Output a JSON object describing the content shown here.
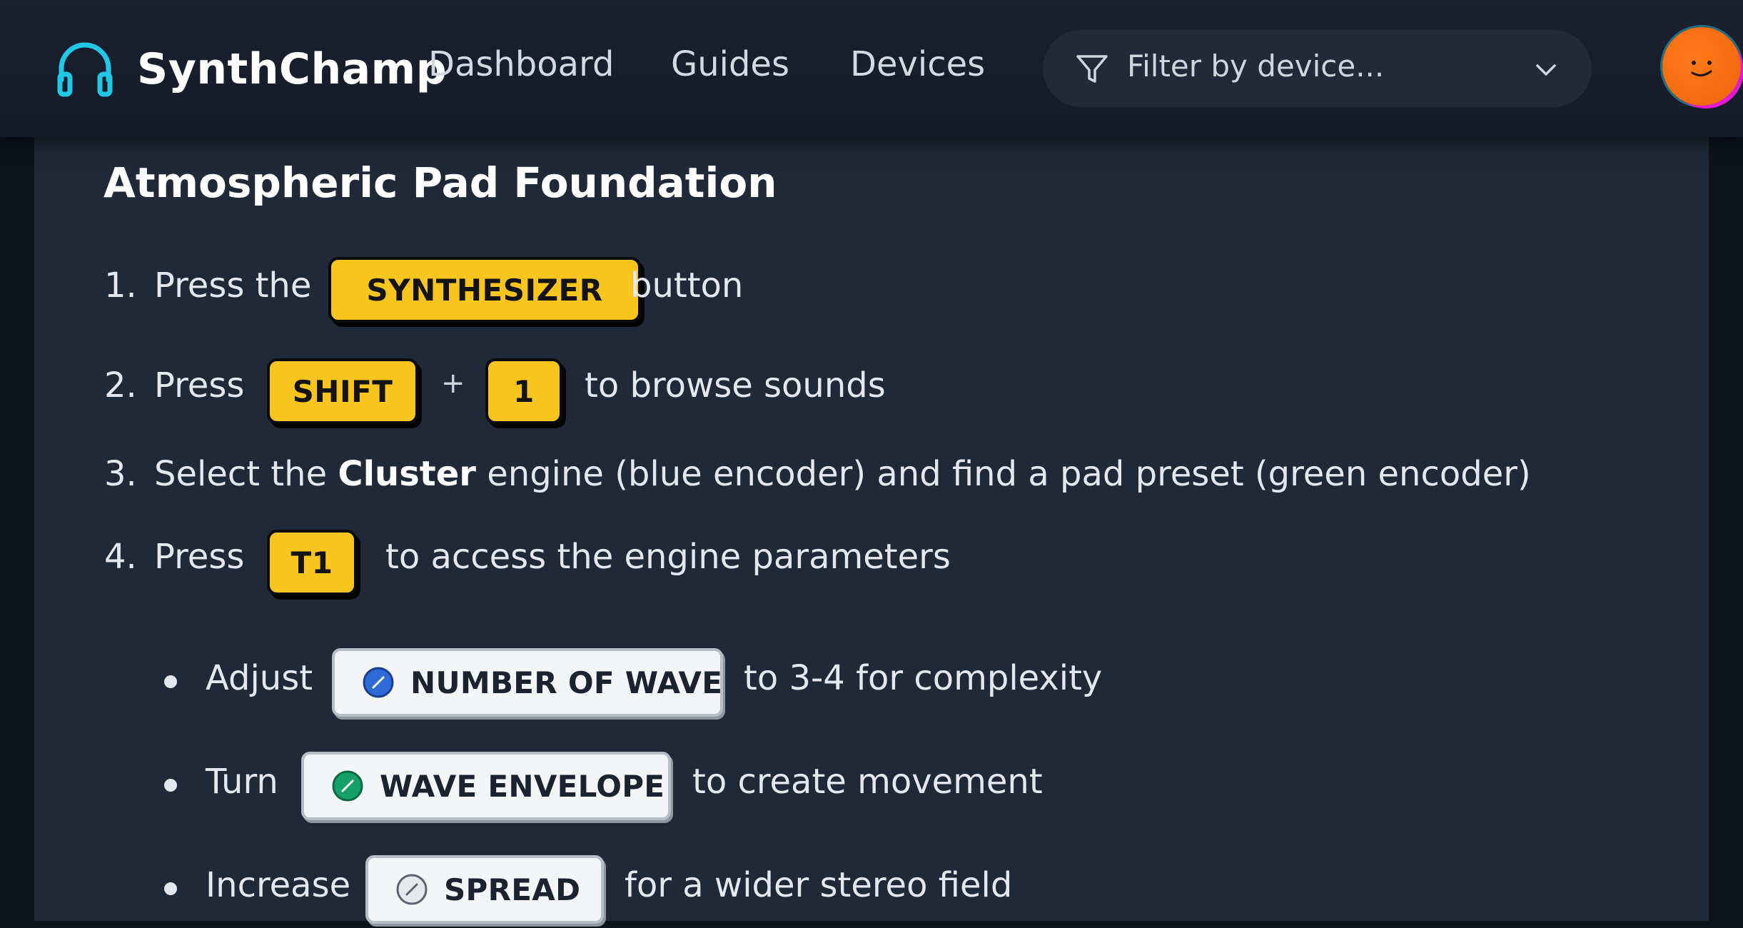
{
  "header": {
    "brand_name": "SynthChamp",
    "nav": [
      "Dashboard",
      "Guides",
      "Devices"
    ],
    "filter": {
      "placeholder": "Filter by device..."
    },
    "colors": {
      "brand_icon": "#22c7e6",
      "avatar": "#f26a0c"
    },
    "icons": {
      "brand": "headphones-icon",
      "filter": "filter-funnel-icon",
      "dropdown": "chevron-down-icon"
    }
  },
  "guide": {
    "title": "Atmospheric Pad Foundation",
    "steps": [
      {
        "number": "1.",
        "before": "Press the",
        "keys": [
          "SYNTHESIZER"
        ],
        "after": "button"
      },
      {
        "number": "2.",
        "before": "Press",
        "keys": [
          "SHIFT",
          "1"
        ],
        "joiner": "+",
        "after": "to browse sounds"
      },
      {
        "number": "3.",
        "before": "Select the",
        "bold": "Cluster",
        "after": "engine (blue encoder) and find a pad preset (green encoder)"
      },
      {
        "number": "4.",
        "before": "Press",
        "keys": [
          "T1"
        ],
        "after": "to access the engine parameters"
      }
    ],
    "substeps": [
      {
        "before": "Adjust",
        "control": "NUMBER OF WAVE",
        "encoder_color": "#2f6bd8",
        "after": "to 3-4 for complexity"
      },
      {
        "before": "Turn",
        "control": "WAVE ENVELOPE",
        "encoder_color": "#16a06a",
        "after": "to create movement"
      },
      {
        "before": "Increase",
        "control": "SPREAD",
        "encoder_color": "#e6e8ec",
        "after": "for a wider stereo field"
      }
    ]
  }
}
